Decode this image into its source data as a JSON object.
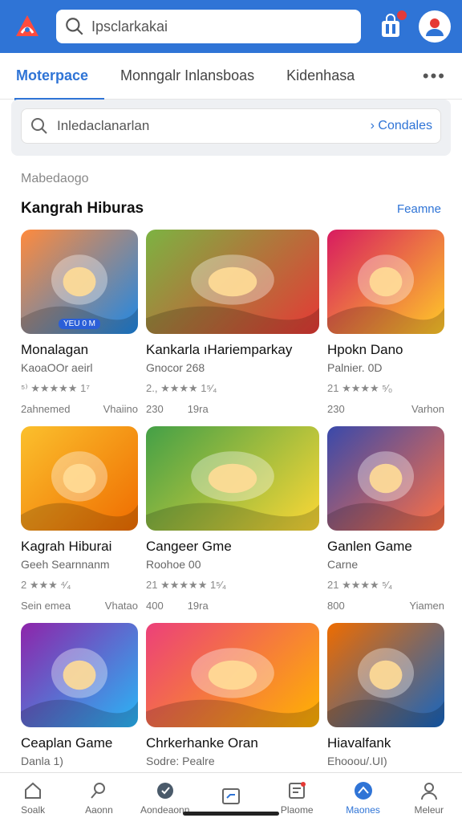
{
  "header": {
    "search_value": "Ipsclarkakai",
    "logo": "brand-logo",
    "icons": [
      "search-icon",
      "shopping-bag-icon",
      "profile-avatar-icon"
    ],
    "accent": "#2f74d6"
  },
  "tabs": [
    {
      "label": "Moterpace",
      "active": true
    },
    {
      "label": "Monngalr Inlansboas",
      "active": false
    },
    {
      "label": "Kidenhasa",
      "active": false
    },
    {
      "label": "•••",
      "active": false
    }
  ],
  "filter": {
    "placeholder": "Inledaclanarlan",
    "cta": "› Condales"
  },
  "section": {
    "subtitle": "Mabedaogo",
    "title": "Kangrah Hiburas",
    "link": "Feamne"
  },
  "cards": [
    {
      "name": "Monalagan",
      "dev": "KaoaOOr aeirl",
      "rating": "⁵⁾ ★★★★★ 1⁷",
      "meta_left": "2ahnemed",
      "meta_right": "Vhaiino",
      "tag": "YEU 0 M",
      "theme": [
        "#ff8a3d",
        "#1e88e5"
      ]
    },
    {
      "name": "Kankarla ıHariemparkay",
      "dev": "Gnocor 268",
      "rating": "2., ★★★★ 1⁵⁄₄",
      "meta_left": "230",
      "meta_right": "19ra",
      "tag": "",
      "theme": [
        "#7cb342",
        "#e53935"
      ]
    },
    {
      "name": "Hpokn Dano",
      "dev": "Palnier. 0D",
      "rating": "21 ★★★★ ⁵⁄₀",
      "meta_left": "230",
      "meta_right": "Varhon",
      "tag": "",
      "theme": [
        "#d81b60",
        "#ffca28"
      ]
    },
    {
      "name": "Kagrah Hiburai",
      "dev": "Geeh Searnnanm",
      "rating": "2 ★★★ ⁴⁄₄",
      "meta_left": "Sein emea",
      "meta_right": "Vhatao",
      "tag": "",
      "theme": [
        "#fbc02d",
        "#ef6c00"
      ]
    },
    {
      "name": "Cangeer Gme",
      "dev": "Roohoe 00",
      "rating": "21 ★★★★★ 1⁵⁄₄",
      "meta_left": "400",
      "meta_right": "19ra",
      "tag": "",
      "theme": [
        "#43a047",
        "#fdd835"
      ]
    },
    {
      "name": "Ganlen Game",
      "dev": "Carne",
      "rating": "21 ★★★★ ⁵⁄₄",
      "meta_left": "800",
      "meta_right": "Yiamen",
      "tag": "",
      "theme": [
        "#3949ab",
        "#ff7043"
      ]
    },
    {
      "name": "Ceaplan Game",
      "dev": "Danla 1)",
      "rating": "",
      "meta_left": "",
      "meta_right": "",
      "tag": "",
      "theme": [
        "#8e24aa",
        "#29b6f6"
      ]
    },
    {
      "name": "Chrkerhanke Oran",
      "dev": "Sodre: Pealre",
      "rating": "",
      "meta_left": "",
      "meta_right": "",
      "tag": "",
      "theme": [
        "#ec407a",
        "#ffb300"
      ]
    },
    {
      "name": "Hiavalfank",
      "dev": "Ehooou/.UI)",
      "rating": "",
      "meta_left": "",
      "meta_right": "",
      "tag": "",
      "theme": [
        "#ef6c00",
        "#1565c0"
      ]
    }
  ],
  "bottom_nav": [
    {
      "label": "Soalk",
      "icon": "home-icon",
      "active": false
    },
    {
      "label": "Aaonn",
      "icon": "search-icon",
      "active": false
    },
    {
      "label": "Aondeaonn",
      "icon": "games-icon",
      "active": false
    },
    {
      "label": "",
      "icon": "library-icon",
      "active": false
    },
    {
      "label": "Plaome",
      "icon": "updates-icon",
      "active": false
    },
    {
      "label": "Maones",
      "icon": "apps-icon",
      "active": true
    },
    {
      "label": "Meleur",
      "icon": "profile-icon",
      "active": false
    }
  ]
}
